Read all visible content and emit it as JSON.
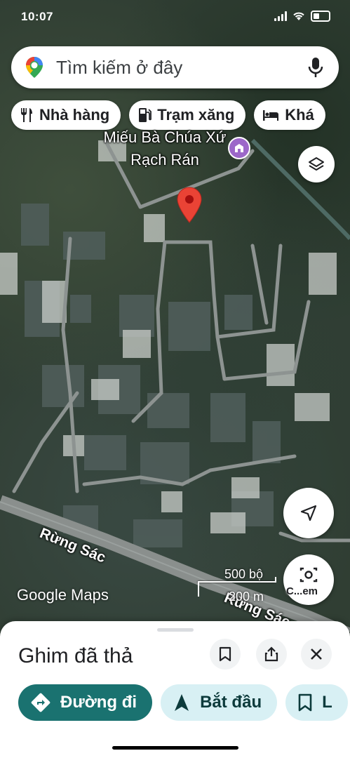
{
  "status_bar": {
    "time": "10:07"
  },
  "search": {
    "placeholder": "Tìm kiếm ở đây"
  },
  "chips": [
    {
      "label": "Nhà hàng",
      "icon": "restaurant-icon"
    },
    {
      "label": "Trạm xăng",
      "icon": "gas-station-icon"
    },
    {
      "label": "Khá",
      "icon": "hotel-icon"
    }
  ],
  "map": {
    "poi_name": "Miếu Bà Chúa Xứ Rạch Rán",
    "road_label_1": "Rừng Sác",
    "road_label_2": "Rừng Sác",
    "watermark": "Google Maps",
    "scale_imperial": "500 bộ",
    "scale_metric": "200 m",
    "lens_label": "C...em"
  },
  "sheet": {
    "title": "Ghim đã thả",
    "actions": {
      "directions": "Đường đi",
      "start": "Bắt đầu",
      "save": "L"
    }
  }
}
